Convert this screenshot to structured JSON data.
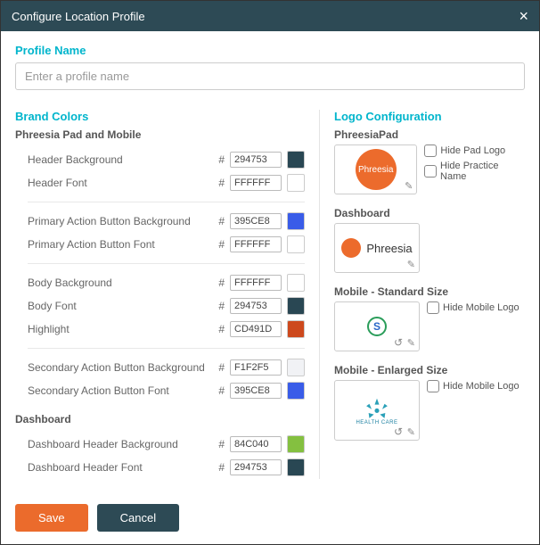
{
  "window": {
    "title": "Configure Location Profile"
  },
  "profile": {
    "section_title": "Profile Name",
    "placeholder": "Enter a profile name",
    "value": ""
  },
  "brand": {
    "section_title": "Brand Colors",
    "pad_mobile_head": "Phreesia Pad and Mobile",
    "dashboard_head": "Dashboard",
    "rows": {
      "header_bg": {
        "label": "Header Background",
        "value": "294753"
      },
      "header_font": {
        "label": "Header Font",
        "value": "FFFFFF"
      },
      "pab_bg": {
        "label": "Primary Action Button Background",
        "value": "395CE8"
      },
      "pab_font": {
        "label": "Primary Action Button Font",
        "value": "FFFFFF"
      },
      "body_bg": {
        "label": "Body Background",
        "value": "FFFFFF"
      },
      "body_font": {
        "label": "Body Font",
        "value": "294753"
      },
      "highlight": {
        "label": "Highlight",
        "value": "CD491D"
      },
      "sab_bg": {
        "label": "Secondary Action Button Background",
        "value": "F1F2F5"
      },
      "sab_font": {
        "label": "Secondary Action Button Font",
        "value": "395CE8"
      },
      "dash_hdr_bg": {
        "label": "Dashboard Header Background",
        "value": "84C040"
      },
      "dash_hdr_font": {
        "label": "Dashboard Header Font",
        "value": "294753"
      }
    }
  },
  "logo": {
    "section_title": "Logo Configuration",
    "groups": {
      "pad": {
        "title": "PhreesiaPad",
        "logo_text": "Phreesia",
        "opts": {
          "hide_pad_logo": "Hide Pad Logo",
          "hide_practice_name": "Hide Practice Name"
        }
      },
      "dash": {
        "title": "Dashboard",
        "logo_text": "Phreesia"
      },
      "mobile_std": {
        "title": "Mobile - Standard Size",
        "opts": {
          "hide_mobile_logo": "Hide Mobile Logo"
        }
      },
      "mobile_enl": {
        "title": "Mobile - Enlarged Size",
        "caption": "HEALTH CARE",
        "opts": {
          "hide_mobile_logo": "Hide Mobile Logo"
        }
      }
    }
  },
  "buttons": {
    "save": "Save",
    "cancel": "Cancel"
  }
}
